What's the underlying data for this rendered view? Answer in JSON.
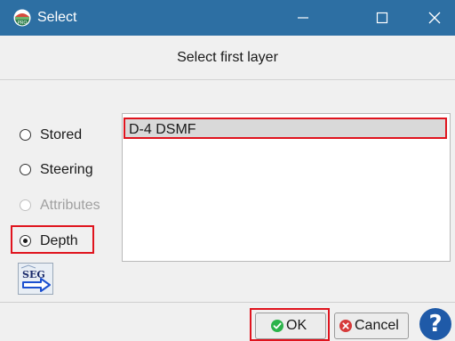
{
  "window": {
    "title": "Select",
    "icon": "pro-app-icon",
    "controls": [
      "minimize-icon",
      "maximize-icon",
      "close-icon"
    ]
  },
  "heading": "Select first layer",
  "options": {
    "stored": "Stored",
    "steering": "Steering",
    "attributes": "Attributes",
    "depth": "Depth",
    "selected": "Depth",
    "disabled": [
      "Attributes"
    ]
  },
  "seg_icon": {
    "label": "SEG",
    "icon": "seg-arrow-icon"
  },
  "list": {
    "items": [
      "D-4  DSMF"
    ],
    "selected": "D-4  DSMF"
  },
  "buttons": {
    "ok": "OK",
    "cancel": "Cancel",
    "help": "?"
  },
  "colors": {
    "titlebar": "#2d6fa3",
    "highlight": "#e0141e",
    "ok_icon": "#2bb34a",
    "cancel_icon": "#d63a3a",
    "help": "#1f5aa8"
  }
}
